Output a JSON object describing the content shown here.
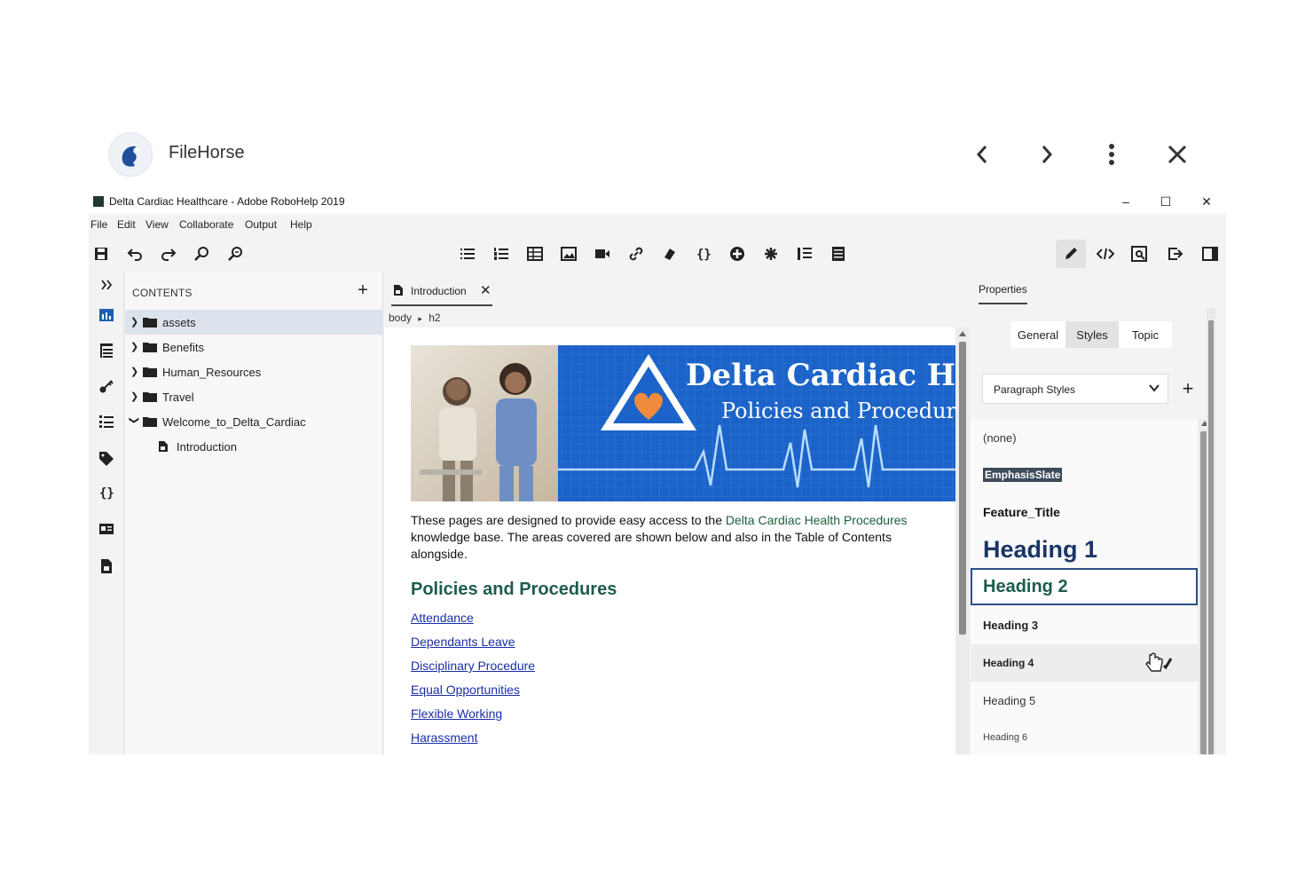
{
  "viewer": {
    "title": "FileHorse"
  },
  "window": {
    "title": "Delta Cardiac Healthcare - Adobe RoboHelp 2019",
    "controls": {
      "minimize": "–",
      "maximize": "☐",
      "close": "✕"
    }
  },
  "menubar": {
    "items": [
      "File",
      "Edit",
      "View",
      "Collaborate",
      "Output",
      "Help"
    ]
  },
  "toolbar": {
    "active_mode": "edit-icon"
  },
  "contents": {
    "title": "CONTENTS",
    "add_label": "+",
    "items": [
      {
        "label": "assets",
        "type": "folder",
        "expanded": false,
        "selected": true
      },
      {
        "label": "Benefits",
        "type": "folder",
        "expanded": false
      },
      {
        "label": "Human_Resources",
        "type": "folder",
        "expanded": false
      },
      {
        "label": "Travel",
        "type": "folder",
        "expanded": false
      },
      {
        "label": "Welcome_to_Delta_Cardiac",
        "type": "folder",
        "expanded": true
      },
      {
        "label": "Introduction",
        "type": "topic",
        "child": true
      }
    ]
  },
  "editor": {
    "tab_label": "Introduction",
    "tab_close": "✕",
    "breadcrumb": {
      "first": "body",
      "sep": "▸",
      "second": "h2"
    },
    "banner": {
      "title": "Delta Cardiac Hea",
      "subtitle": "Policies and Procedur"
    },
    "intro": {
      "before": "These pages are designed to provide easy access to the ",
      "link": "Delta Cardiac Health Procedures",
      "after": " knowledge base. The areas covered are shown below and also in the Table of Contents alongside."
    },
    "heading": "Policies and Procedures",
    "links": [
      "Attendance",
      "Dependants Leave",
      "Disciplinary Procedure",
      "Equal Opportunities",
      "Flexible Working",
      "Harassment"
    ]
  },
  "properties": {
    "title": "Properties",
    "tabs": [
      "General",
      "Styles",
      "Topic"
    ],
    "active_tab": "Styles",
    "style_dropdown": "Paragraph Styles",
    "add_label": "+",
    "styles": [
      "(none)",
      "EmphasisSlate",
      "Feature_Title",
      "Heading 1",
      "Heading 2",
      "Heading 3",
      "Heading 4",
      "Heading 5",
      "Heading 6"
    ],
    "selected_style": "Heading 2"
  },
  "colors": {
    "accent": "#1b63c8",
    "heading": "#1e5c4e",
    "link": "#1a2ea8",
    "heading1": "#1a3566"
  }
}
